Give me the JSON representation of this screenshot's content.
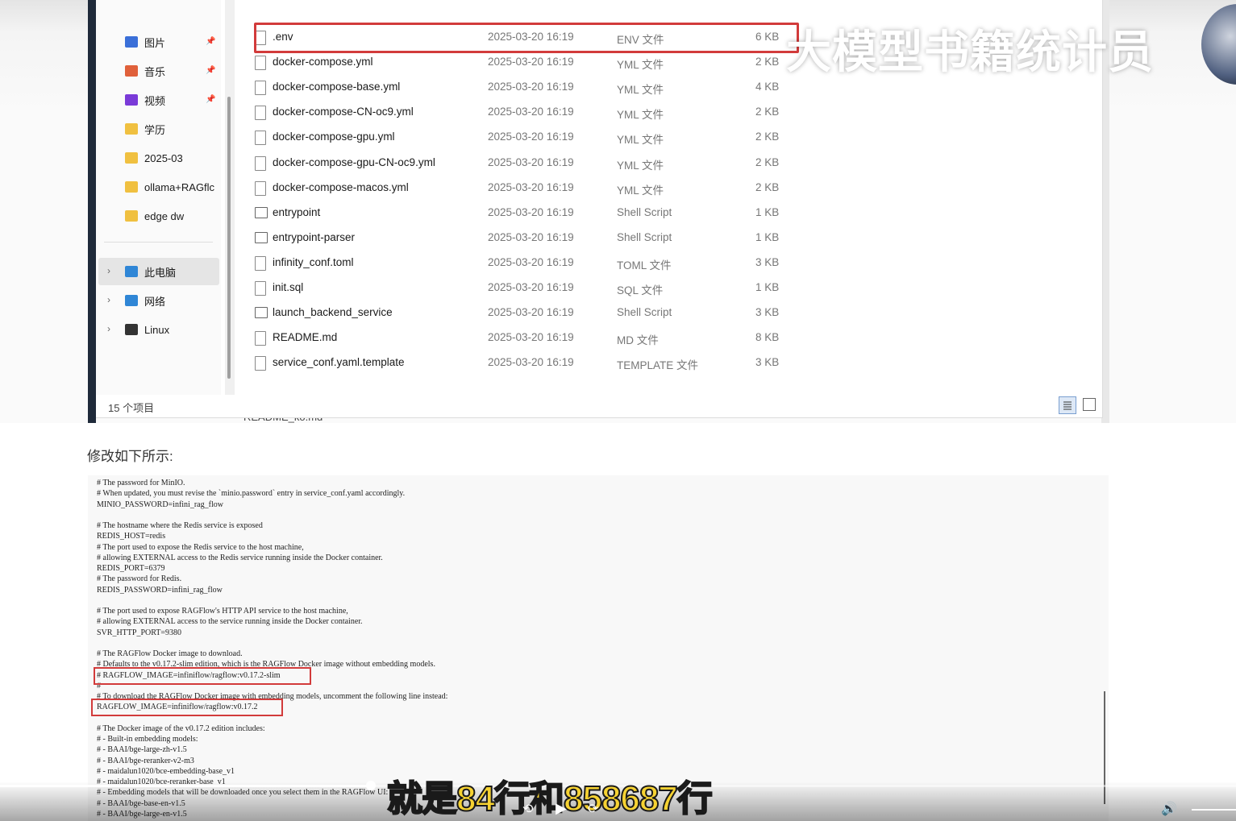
{
  "watermark": "大模型书籍统计员",
  "sidebar": {
    "items": [
      {
        "label": "图片",
        "pinned": true,
        "color": "#3a6fd8"
      },
      {
        "label": "音乐",
        "pinned": true,
        "color": "#e0603a"
      },
      {
        "label": "视频",
        "pinned": true,
        "color": "#7a3ad8"
      },
      {
        "label": "学历",
        "pinned": false,
        "color": "#f0c040"
      },
      {
        "label": "2025-03",
        "pinned": false,
        "color": "#f0c040"
      },
      {
        "label": "ollama+RAGflc",
        "pinned": false,
        "color": "#f0c040"
      },
      {
        "label": "edge dw",
        "pinned": false,
        "color": "#f0c040"
      }
    ],
    "drives": [
      {
        "label": "此电脑",
        "selected": true
      },
      {
        "label": "网络",
        "selected": false
      },
      {
        "label": "Linux",
        "selected": false
      }
    ],
    "pin_glyph": "📌",
    "chevron": "›"
  },
  "files": [
    {
      "name": ".env",
      "date": "2025-03-20 16:19",
      "type": "ENV 文件",
      "size": "6 KB",
      "icon": "file-icon",
      "highlighted": true
    },
    {
      "name": "docker-compose.yml",
      "date": "2025-03-20 16:19",
      "type": "YML 文件",
      "size": "2 KB",
      "icon": "file-icon"
    },
    {
      "name": "docker-compose-base.yml",
      "date": "2025-03-20 16:19",
      "type": "YML 文件",
      "size": "4 KB",
      "icon": "file-icon"
    },
    {
      "name": "docker-compose-CN-oc9.yml",
      "date": "2025-03-20 16:19",
      "type": "YML 文件",
      "size": "2 KB",
      "icon": "file-icon"
    },
    {
      "name": "docker-compose-gpu.yml",
      "date": "2025-03-20 16:19",
      "type": "YML 文件",
      "size": "2 KB",
      "icon": "file-icon"
    },
    {
      "name": "docker-compose-gpu-CN-oc9.yml",
      "date": "2025-03-20 16:19",
      "type": "YML 文件",
      "size": "2 KB",
      "icon": "file-icon"
    },
    {
      "name": "docker-compose-macos.yml",
      "date": "2025-03-20 16:19",
      "type": "YML 文件",
      "size": "2 KB",
      "icon": "file-icon"
    },
    {
      "name": "entrypoint",
      "date": "2025-03-20 16:19",
      "type": "Shell Script",
      "size": "1 KB",
      "icon": "script-icon"
    },
    {
      "name": "entrypoint-parser",
      "date": "2025-03-20 16:19",
      "type": "Shell Script",
      "size": "1 KB",
      "icon": "script-icon"
    },
    {
      "name": "infinity_conf.toml",
      "date": "2025-03-20 16:19",
      "type": "TOML 文件",
      "size": "3 KB",
      "icon": "file-icon"
    },
    {
      "name": "init.sql",
      "date": "2025-03-20 16:19",
      "type": "SQL 文件",
      "size": "1 KB",
      "icon": "file-icon"
    },
    {
      "name": "launch_backend_service",
      "date": "2025-03-20 16:19",
      "type": "Shell Script",
      "size": "3 KB",
      "icon": "script-icon"
    },
    {
      "name": "README.md",
      "date": "2025-03-20 16:19",
      "type": "MD 文件",
      "size": "8 KB",
      "icon": "file-icon"
    },
    {
      "name": "service_conf.yaml.template",
      "date": "2025-03-20 16:19",
      "type": "TEMPLATE 文件",
      "size": "3 KB",
      "icon": "file-icon"
    }
  ],
  "status": "15 个项目",
  "behind_text": "README_ko.md",
  "page_heading": "修改如下所示:",
  "code_lines": [
    "# The password for MinIO.",
    "# When updated, you must revise the `minio.password` entry in service_conf.yaml accordingly.",
    "MINIO_PASSWORD=infini_rag_flow",
    "",
    "# The hostname where the Redis service is exposed",
    "REDIS_HOST=redis",
    "# The port used to expose the Redis service to the host machine,",
    "# allowing EXTERNAL access to the Redis service running inside the Docker container.",
    "REDIS_PORT=6379",
    "# The password for Redis.",
    "REDIS_PASSWORD=infini_rag_flow",
    "",
    "# The port used to expose RAGFlow's HTTP API service to the host machine,",
    "# allowing EXTERNAL access to the service running inside the Docker container.",
    "SVR_HTTP_PORT=9380",
    "",
    "# The RAGFlow Docker image to download.",
    "# Defaults to the v0.17.2-slim edition, which is the RAGFlow Docker image without embedding models.",
    "# RAGFLOW_IMAGE=infiniflow/ragflow:v0.17.2-slim",
    "#",
    "# To download the RAGFlow Docker image with embedding models, uncomment the following line instead:",
    "RAGFLOW_IMAGE=infiniflow/ragflow:v0.17.2",
    "",
    "# The Docker image of the v0.17.2 edition includes:",
    "# - Built-in embedding models:",
    "#   - BAAI/bge-large-zh-v1.5",
    "#   - BAAI/bge-reranker-v2-m3",
    "#   - maidalun1020/bce-embedding-base_v1",
    "#   - maidalun1020/bce-reranker-base_v1",
    "# - Embedding models that will be downloaded once you select them in the RAGFlow UI:",
    "#   - BAAI/bge-base-en-v1.5",
    "#   - BAAI/bge-large-en-v1.5"
  ],
  "code_highlights": [
    18,
    21
  ],
  "subtitle": "就是84行和858687行",
  "video": {
    "progress": 0.3,
    "controls": {
      "rewind": "⟲",
      "play": "▶",
      "forward": "⟳",
      "volume": "🔊"
    }
  }
}
